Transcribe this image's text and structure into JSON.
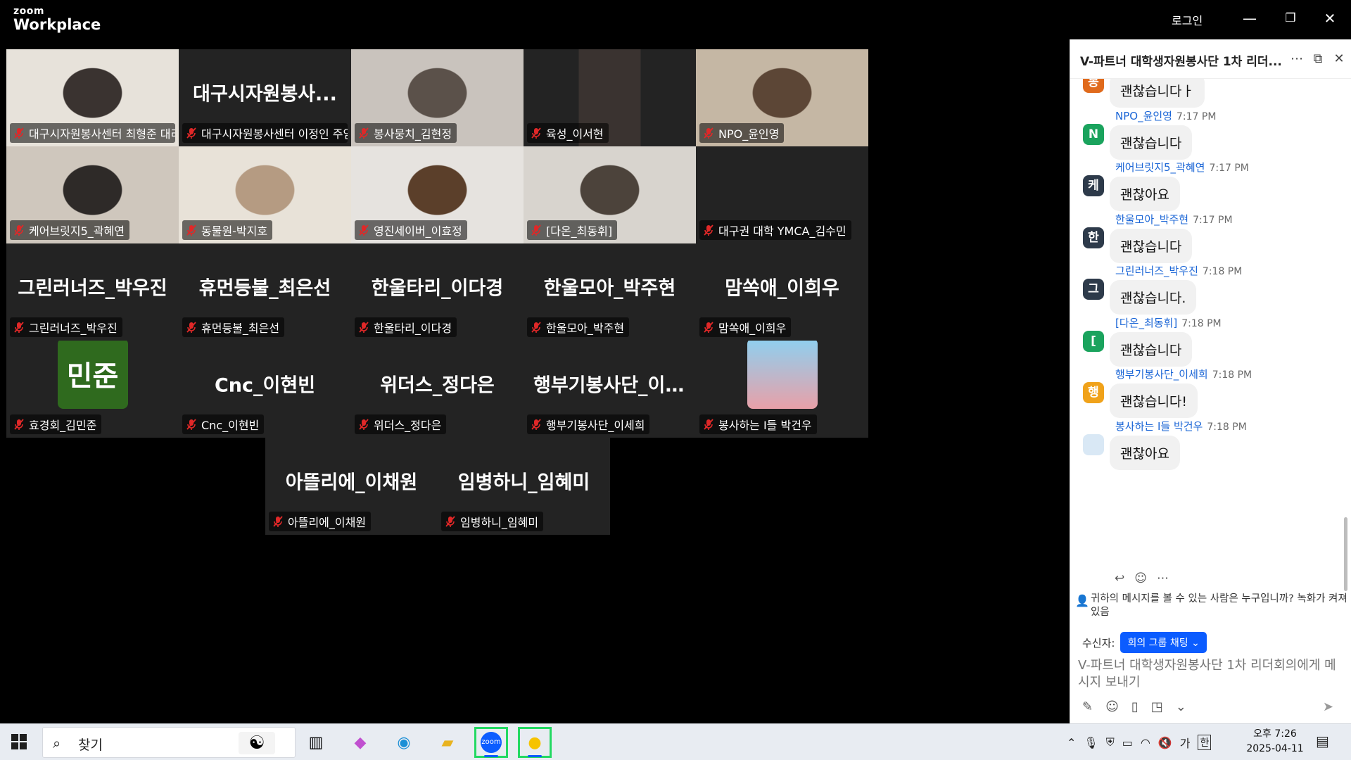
{
  "app": {
    "logo_top": "zoom",
    "logo_bottom": "Workplace",
    "login": "로그인"
  },
  "tiles": [
    {
      "name": "대구시자원봉사센터 최형준 대리",
      "center": "",
      "active": true
    },
    {
      "name": "대구시자원봉사센터 이정인 주임",
      "center": "대구시자원봉사..."
    },
    {
      "name": "봉사뭉치_김현정",
      "center": ""
    },
    {
      "name": "육성_이서현",
      "center": ""
    },
    {
      "name": "NPO_윤인영",
      "center": ""
    },
    {
      "name": "케어브릿지5_곽혜연",
      "center": ""
    },
    {
      "name": "동물원-박지호",
      "center": ""
    },
    {
      "name": "영진세이버_이효정",
      "center": ""
    },
    {
      "name": "[다온_최동휘]",
      "center": ""
    },
    {
      "name": "대구권 대학 YMCA_김수민",
      "center": ""
    },
    {
      "name": "그린러너즈_박우진",
      "center": "그린러너즈_박우진"
    },
    {
      "name": "휴먼등불_최은선",
      "center": "휴먼등불_최은선"
    },
    {
      "name": "한울타리_이다경",
      "center": "한울타리_이다경"
    },
    {
      "name": "한울모아_박주현",
      "center": "한울모아_박주현"
    },
    {
      "name": "맘쏙애_이희우",
      "center": "맘쏙애_이희우"
    },
    {
      "name": "효경회_김민준",
      "center": "",
      "avatar_text": "민준",
      "avatar_color": "#2f6a1e"
    },
    {
      "name": "Cnc_이현빈",
      "center": "Cnc_이현빈"
    },
    {
      "name": "위더스_정다은",
      "center": "위더스_정다은"
    },
    {
      "name": "행부기봉사단_이세희",
      "center": "행부기봉사단_이..."
    },
    {
      "name": "봉사하는 I들 박건우",
      "center": ""
    },
    {
      "name": "아뜰리에_이채원",
      "center": "아뜰리에_이채원"
    },
    {
      "name": "임병하니_임혜미",
      "center": "임병하니_임혜미"
    }
  ],
  "chat": {
    "title": "V-파트너 대학생자원봉사단 1차 리더...",
    "messages": [
      {
        "avatar": "봉",
        "color": "#e06a1c",
        "sender": "",
        "time": "",
        "text": "괜찮습니다ㅏ"
      },
      {
        "avatar": "N",
        "color": "#1aa35d",
        "sender": "NPO_윤인영",
        "time": "7:17 PM",
        "text": "괜찮습니다"
      },
      {
        "avatar": "케",
        "color": "#2d3a4a",
        "sender": "케어브릿지5_곽혜연",
        "time": "7:17 PM",
        "text": "괜찮아요"
      },
      {
        "avatar": "한",
        "color": "#2d3a4a",
        "sender": "한울모아_박주현",
        "time": "7:17 PM",
        "text": "괜찮습니다"
      },
      {
        "avatar": "그",
        "color": "#2d3a4a",
        "sender": "그린러너즈_박우진",
        "time": "7:18 PM",
        "text": "괜찮습니다."
      },
      {
        "avatar": "[",
        "color": "#1aa35d",
        "sender": "[다온_최동휘]",
        "time": "7:18 PM",
        "text": "괜찮습니다"
      },
      {
        "avatar": "행",
        "color": "#f0a21a",
        "sender": "행부기봉사단_이세희",
        "time": "7:18 PM",
        "text": "괜찮습니다!"
      },
      {
        "avatar": "",
        "color": "#d9e8f5",
        "sender": "봉사하는 I들 박건우",
        "time": "7:18 PM",
        "text": "괜찮아요"
      }
    ],
    "privacy": "귀하의 메시지를 볼 수 있는 사람은 누구입니까? 녹화가 켜져 있음",
    "to_label": "수신자:",
    "to_value": "회의 그룹 채팅",
    "compose_placeholder": "V-파트너 대학생자원봉사단 1차 리더회의에게 메시지 보내기"
  },
  "taskbar": {
    "search_text": "찾기",
    "ime": "가",
    "lang": "한",
    "time": "오후 7:26",
    "date": "2025-04-11"
  }
}
